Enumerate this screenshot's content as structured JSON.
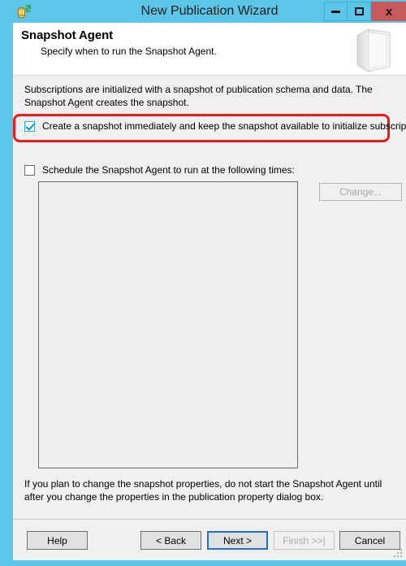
{
  "window": {
    "title": "New Publication Wizard",
    "app_icon": "replication-database-icon",
    "frame_color": "#5bc6e8",
    "controls": {
      "minimize_label": "–",
      "maximize_label": "□",
      "close_label": "x",
      "close_color": "#c75b5b"
    }
  },
  "header": {
    "title": "Snapshot Agent",
    "subtitle": "Specify when to run the Snapshot Agent.",
    "banner_icon": "book-icon"
  },
  "main": {
    "intro": "Subscriptions are initialized with a snapshot of publication schema and data. The Snapshot Agent creates the snapshot.",
    "checkboxes": [
      {
        "label": "Create a snapshot immediately and keep the snapshot available to initialize subscriptions",
        "checked": true,
        "highlighted": true
      },
      {
        "label": "Schedule the Snapshot Agent to run at the following times:",
        "checked": false,
        "highlighted": false
      }
    ],
    "schedule_list": {
      "items": [],
      "enabled": false
    },
    "change_button": {
      "label": "Change...",
      "enabled": false
    },
    "note": "If you plan to change the snapshot properties, do not start the Snapshot Agent until after you change the properties in the publication property dialog box."
  },
  "annotation": {
    "color": "#ee1b1b",
    "shape": "rounded-rectangle"
  },
  "footer": {
    "buttons": [
      {
        "label": "Help",
        "enabled": true,
        "focused": false
      },
      {
        "label": "< Back",
        "enabled": true,
        "focused": false
      },
      {
        "label": "Next >",
        "enabled": true,
        "focused": true
      },
      {
        "label": "Finish >>|",
        "enabled": false,
        "focused": false
      },
      {
        "label": "Cancel",
        "enabled": true,
        "focused": false
      }
    ]
  }
}
